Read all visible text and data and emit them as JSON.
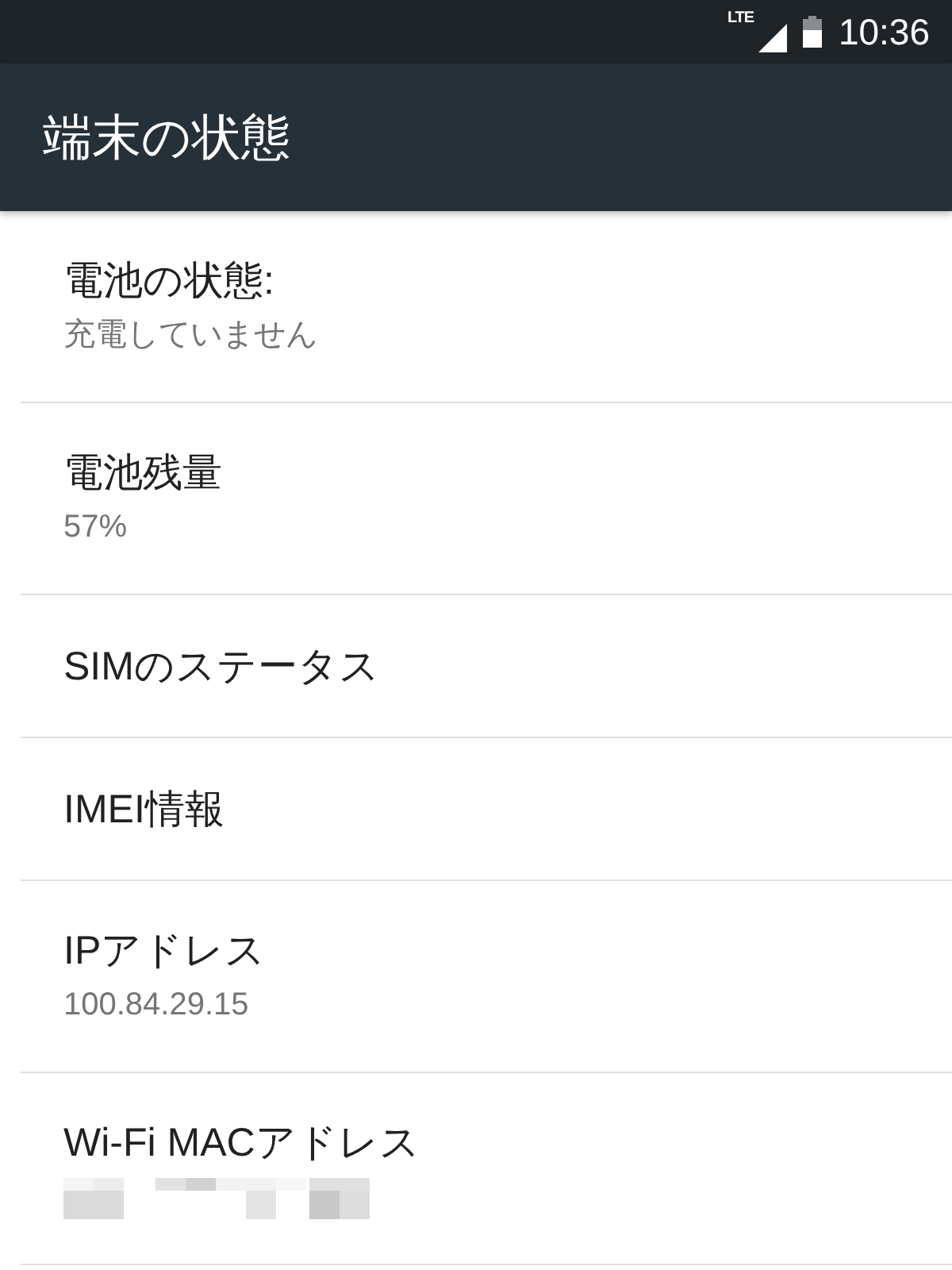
{
  "status_bar": {
    "network_type": "LTE",
    "time": "10:36"
  },
  "toolbar": {
    "title": "端末の状態"
  },
  "items": [
    {
      "title": "電池の状態:",
      "summary": "充電していません",
      "summary_redacted": false
    },
    {
      "title": "電池残量",
      "summary": "57%",
      "summary_redacted": false
    },
    {
      "title": "SIMのステータス",
      "summary_redacted": false
    },
    {
      "title": "IMEI情報",
      "summary_redacted": false
    },
    {
      "title": "IPアドレス",
      "summary": "100.84.29.15",
      "summary_redacted": false
    },
    {
      "title": "Wi-Fi MACアドレス",
      "summary_redacted": true
    }
  ]
}
